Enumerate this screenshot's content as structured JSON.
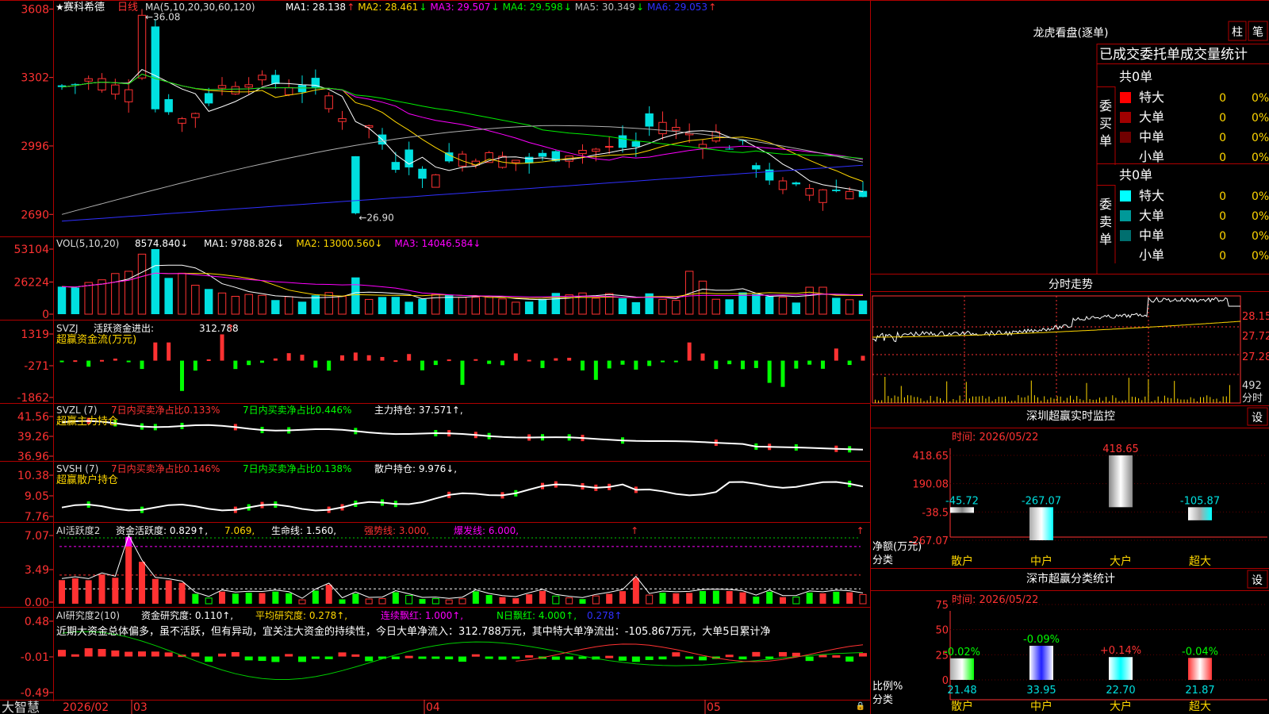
{
  "colors": {
    "up": "#ff3232",
    "down": "#00e0e0",
    "bg": "#000000",
    "border": "#b00000",
    "white": "#ffffff",
    "yellow": "#ffd700",
    "magenta": "#ff00ff",
    "green": "#00dd00",
    "blue": "#3030ff",
    "gray": "#b0b0b0",
    "vgreen": "#00ff00"
  },
  "header": {
    "star": "★",
    "name": "赛科希德",
    "period": "日线",
    "ma_params": "MA(5,10,20,30,60,120)",
    "ma": [
      {
        "label": "MA1:",
        "value": "28.138",
        "arrow": "↑",
        "color": "#ffffff"
      },
      {
        "label": "MA2:",
        "value": "28.461",
        "arrow": "↓",
        "color": "#ffd700"
      },
      {
        "label": "MA3:",
        "value": "29.507",
        "arrow": "↓",
        "color": "#ff00ff"
      },
      {
        "label": "MA4:",
        "value": "29.598",
        "arrow": "↓",
        "color": "#00ee00"
      },
      {
        "label": "MA5:",
        "value": "30.349",
        "arrow": "↓",
        "color": "#c0c0c0"
      },
      {
        "label": "MA6:",
        "value": "29.053",
        "arrow": "↑",
        "color": "#3030ff"
      }
    ]
  },
  "price_panel": {
    "yticks": [
      "3608",
      "3302",
      "2996",
      "2690"
    ],
    "high_label": "36.08",
    "low_label": "26.90"
  },
  "vol_panel": {
    "title": "VOL(5,10,20)",
    "value": "8574.840↓",
    "ma": [
      {
        "t": "MA1: 9788.826↓",
        "c": "#ffffff"
      },
      {
        "t": "MA2: 13000.560↓",
        "c": "#ffd700"
      },
      {
        "t": "MA3: 14046.584↓",
        "c": "#ff00ff"
      }
    ],
    "yticks": [
      "53104",
      "26224",
      "0"
    ]
  },
  "svzj_panel": {
    "title": "SVZJ",
    "label": "活跃资金进出:",
    "value": "312.788",
    "arrow": "↑",
    "name": "超赢资金流(万元)",
    "yticks": [
      "1319",
      "-271",
      "-1862"
    ]
  },
  "svzl_panel": {
    "title": "SVZL (7)",
    "a": "7日内买卖净占比0.133%",
    "b": "7日内买卖净占比0.446%",
    "c": "主力持仓: 37.571↑,",
    "name": "超赢主力持仓",
    "yticks": [
      "41.56",
      "39.26",
      "36.96"
    ]
  },
  "svsh_panel": {
    "title": "SVSH (7)",
    "a": "7日内买卖净占比0.146%",
    "b": "7日内买卖净占比0.138%",
    "c": "散户持仓: 9.976↓,",
    "name": "超赢散户持仓",
    "yticks": [
      "10.38",
      "9.05",
      "7.76"
    ]
  },
  "ai1_panel": {
    "title": "AI活跃度2",
    "a": "资金活跃度: 0.829↑,",
    "b": "7.069,",
    "c": "生命线: 1.560,",
    "d": "强势线: 3.000,",
    "e": "爆发线: 6.000,",
    "yticks": [
      "7.07",
      "3.49",
      "0.00"
    ]
  },
  "ai2_panel": {
    "title": "AI研究度2(10)",
    "a": "资金研究度: 0.110↑,",
    "b": "平均研究度: 0.278↑,",
    "c": "连续飘红: 1.000↑,",
    "d": "N日飘红: 4.000↑,",
    "e": "0.278↑",
    "note": "近期大资金总体偏多，虽不活跃，但有异动，宜关注大资金的持续性，今日大单净流入：312.788万元，其中特大单净流出：-105.867万元，大单5日累计净",
    "yticks": [
      "0.48",
      "-0.01",
      "-0.49"
    ]
  },
  "bottom": {
    "logo": "大智慧",
    "date": "2026/02",
    "months": [
      "03",
      "04",
      "05"
    ]
  },
  "dragon": {
    "title": "龙虎看盘(逐单)",
    "btn1": "柱",
    "btn2": "笔",
    "subtitle": "已成交委托单成交量统计",
    "buy": {
      "side": "委买单",
      "total": "共0单",
      "rows": [
        {
          "name": "特大",
          "v": "0",
          "p": "0%",
          "color": "#ff0000"
        },
        {
          "name": "大单",
          "v": "0",
          "p": "0%",
          "color": "#a00000"
        },
        {
          "name": "中单",
          "v": "0",
          "p": "0%",
          "color": "#700000"
        },
        {
          "name": "小单",
          "v": "0",
          "p": "0%",
          "color": "#000000"
        }
      ]
    },
    "sell": {
      "side": "委卖单",
      "total": "共0单",
      "rows": [
        {
          "name": "特大",
          "v": "0",
          "p": "0%",
          "color": "#00ffff"
        },
        {
          "name": "大单",
          "v": "0",
          "p": "0%",
          "color": "#009999"
        },
        {
          "name": "中单",
          "v": "0",
          "p": "0%",
          "color": "#006f6f"
        },
        {
          "name": "小单",
          "v": "0",
          "p": "0%",
          "color": "#000000"
        }
      ]
    }
  },
  "intraday": {
    "title": "分时走势",
    "yticks": [
      "28.15",
      "27.72",
      "27.28"
    ],
    "vol_label": "492",
    "vol_unit": "分时"
  },
  "monitor": {
    "title": "深圳超赢实时监控",
    "btn": "设",
    "time": "时间: 2026/05/22",
    "yticks": [
      "418.65",
      "190.08",
      "-38.5",
      "-267.07"
    ],
    "ylabel": "净额(万元)",
    "xlabel": "分类"
  },
  "classify": {
    "title": "深市超赢分类统计",
    "btn": "设",
    "time": "时间: 2026/05/22",
    "yticks": [
      "75",
      "50",
      "25",
      "0"
    ],
    "ylabel": "比例%",
    "xlabel": "分类"
  },
  "chart_data": [
    {
      "type": "bar",
      "title": "深圳超赢实时监控",
      "ylabel": "净额(万元)",
      "xlabel": "分类",
      "categories": [
        "散户",
        "中户",
        "大户",
        "超大"
      ],
      "values": [
        -45.72,
        -267.07,
        418.65,
        -105.87
      ],
      "ylim": [
        -267.07,
        418.65
      ]
    },
    {
      "type": "bar",
      "title": "深市超赢分类统计",
      "ylabel": "比例%",
      "xlabel": "分类",
      "categories": [
        "散户",
        "中户",
        "大户",
        "超大"
      ],
      "values": [
        21.48,
        33.95,
        22.7,
        21.87
      ],
      "change_labels": [
        "-0.02%",
        "-0.09%",
        "+0.14%",
        "-0.04%"
      ],
      "ylim": [
        0,
        75
      ]
    }
  ]
}
